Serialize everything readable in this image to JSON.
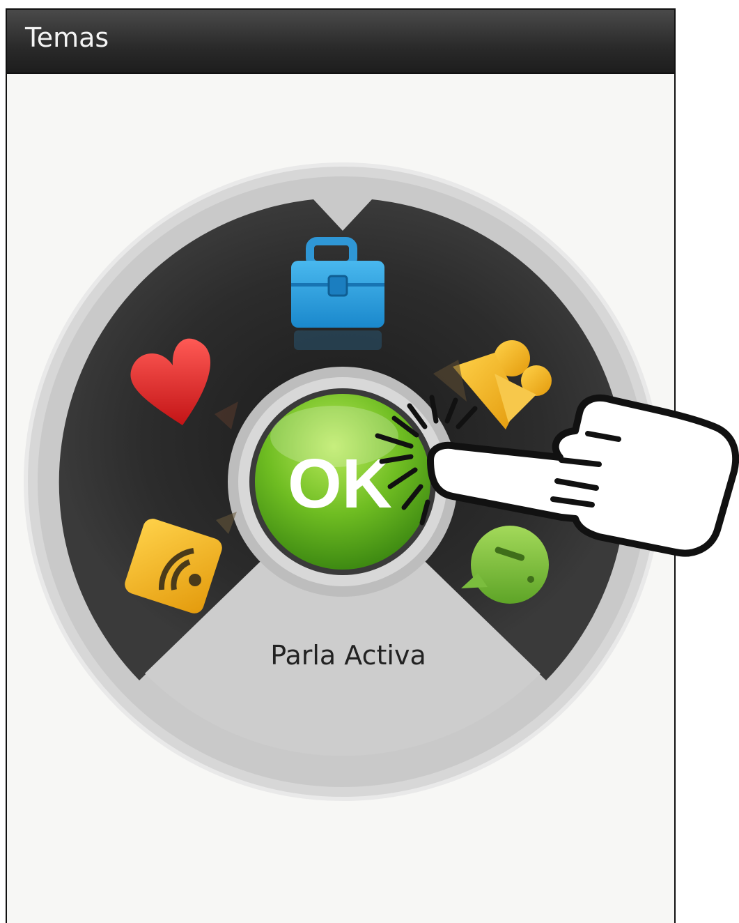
{
  "app": {
    "title": "Temas"
  },
  "wheel": {
    "center_button": {
      "label": "OK",
      "icon": "ok-button"
    },
    "selected_label": "Parla Activa",
    "items": [
      {
        "icon": "briefcase-icon",
        "color": "#2aa3e0"
      },
      {
        "icon": "heart-icon",
        "color": "#e0262a"
      },
      {
        "icon": "family-icon",
        "color": "#f1b21e"
      },
      {
        "icon": "rss-icon",
        "color": "#f3bd22"
      },
      {
        "icon": "chat-bubble-icon",
        "color": "#8cc63f"
      }
    ]
  },
  "overlay": {
    "icon": "tap-hand-icon"
  },
  "colors": {
    "accent": "#7cc42d",
    "titlebar": "#2a2a2a",
    "ring": "#cfcfcf"
  }
}
